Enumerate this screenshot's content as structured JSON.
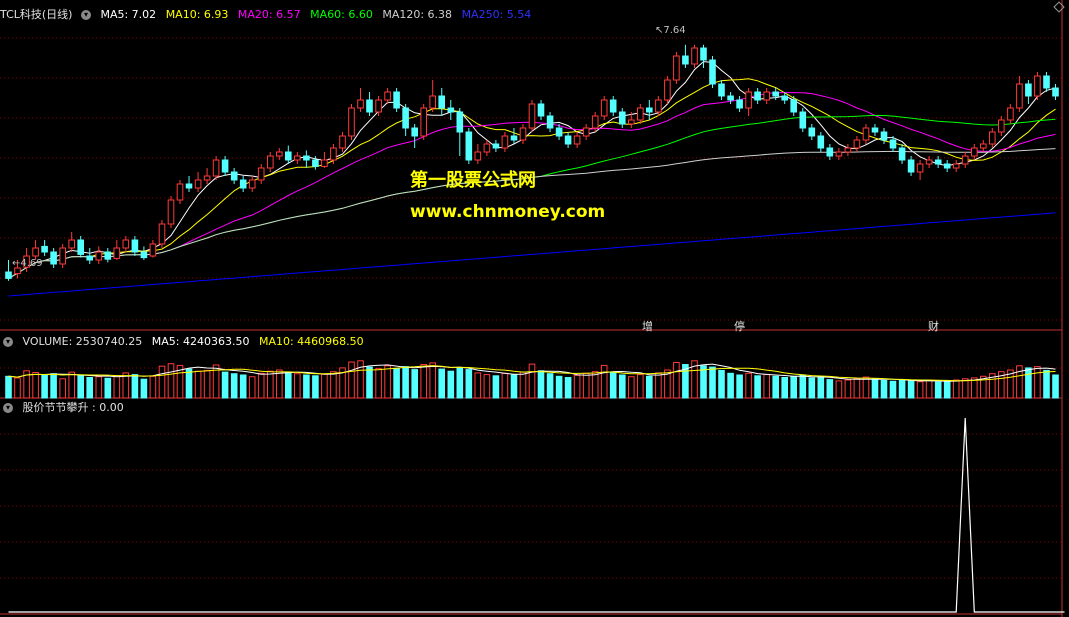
{
  "colors": {
    "up": "#ff3a3a",
    "down": "#54ffff",
    "ma5": "#ffffff",
    "ma10": "#ffff00",
    "ma20": "#ff00ff",
    "ma60": "#00ff00",
    "ma120": "#cfcfcf",
    "ma250": "#0000ff",
    "grid": "#8b0000",
    "watermark": "#ffff00"
  },
  "header": {
    "menu_icon": "chevron-down-icon",
    "title": "TCL科技(日线)",
    "ma5": "MA5: 7.02",
    "ma10": "MA10: 6.93",
    "ma20": "MA20: 6.57",
    "ma60": "MA60: 6.60",
    "ma120": "MA120: 6.38",
    "ma250": "MA250: 5.54"
  },
  "volume_header": {
    "label": "VOLUME: 2530740.25",
    "ma5": "MA5: 4240363.50",
    "ma10": "MA10: 4460968.50"
  },
  "indicator_header": {
    "label": "股价节节攀升 : 0.00"
  },
  "watermark": {
    "line1": "第一股票公式网",
    "line2": "www.chnmoney.com"
  },
  "annotations": {
    "low": "4.69",
    "high": "7.64"
  },
  "event_flags": [
    {
      "text": "增",
      "color": "#ff3a3a"
    },
    {
      "text": "停",
      "color": "#54ffff"
    },
    {
      "text": "财",
      "color": "#54ffff"
    }
  ],
  "chart_data": [
    {
      "type": "candlestick",
      "title": "TCL科技(日线)",
      "annotations": {
        "low": 4.69,
        "high": 7.64
      },
      "ylim": [
        4.3,
        7.9
      ],
      "candles": [
        [
          4.8,
          4.72,
          4.95,
          4.69
        ],
        [
          4.78,
          4.85,
          4.95,
          4.72
        ],
        [
          4.86,
          5.0,
          5.1,
          4.8
        ],
        [
          5.0,
          5.1,
          5.2,
          4.95
        ],
        [
          5.12,
          5.05,
          5.2,
          5.0
        ],
        [
          5.05,
          4.9,
          5.1,
          4.85
        ],
        [
          4.9,
          5.1,
          5.15,
          4.85
        ],
        [
          5.1,
          5.2,
          5.3,
          5.05
        ],
        [
          5.2,
          5.02,
          5.25,
          4.98
        ],
        [
          5.0,
          4.95,
          5.1,
          4.9
        ],
        [
          4.95,
          5.05,
          5.12,
          4.9
        ],
        [
          5.05,
          4.96,
          5.1,
          4.92
        ],
        [
          4.97,
          5.1,
          5.2,
          4.95
        ],
        [
          5.1,
          5.2,
          5.25,
          5.05
        ],
        [
          5.2,
          5.05,
          5.25,
          5.0
        ],
        [
          5.05,
          4.98,
          5.12,
          4.95
        ],
        [
          5.0,
          5.15,
          5.2,
          4.98
        ],
        [
          5.15,
          5.4,
          5.45,
          5.1
        ],
        [
          5.4,
          5.7,
          5.75,
          5.35
        ],
        [
          5.7,
          5.9,
          5.95,
          5.65
        ],
        [
          5.9,
          5.85,
          6.0,
          5.8
        ],
        [
          5.85,
          5.95,
          6.05,
          5.8
        ],
        [
          5.95,
          6.0,
          6.1,
          5.9
        ],
        [
          6.0,
          6.2,
          6.25,
          5.95
        ],
        [
          6.2,
          6.05,
          6.25,
          6.0
        ],
        [
          6.05,
          5.95,
          6.1,
          5.9
        ],
        [
          5.95,
          5.85,
          6.0,
          5.8
        ],
        [
          5.85,
          5.95,
          6.0,
          5.8
        ],
        [
          5.95,
          6.1,
          6.15,
          5.9
        ],
        [
          6.1,
          6.25,
          6.3,
          6.05
        ],
        [
          6.25,
          6.3,
          6.35,
          6.2
        ],
        [
          6.3,
          6.2,
          6.38,
          6.15
        ],
        [
          6.2,
          6.25,
          6.3,
          6.15
        ],
        [
          6.25,
          6.2,
          6.32,
          6.1
        ],
        [
          6.2,
          6.12,
          6.25,
          6.08
        ],
        [
          6.12,
          6.2,
          6.3,
          6.1
        ],
        [
          6.2,
          6.35,
          6.4,
          6.15
        ],
        [
          6.35,
          6.5,
          6.55,
          6.3
        ],
        [
          6.5,
          6.85,
          6.9,
          6.45
        ],
        [
          6.85,
          6.95,
          7.1,
          6.8
        ],
        [
          6.95,
          6.8,
          7.05,
          6.75
        ],
        [
          6.8,
          6.95,
          7.0,
          6.75
        ],
        [
          6.95,
          7.05,
          7.1,
          6.9
        ],
        [
          7.05,
          6.85,
          7.1,
          6.8
        ],
        [
          6.85,
          6.6,
          6.9,
          6.5
        ],
        [
          6.6,
          6.5,
          6.65,
          6.35
        ],
        [
          6.5,
          6.85,
          6.9,
          6.45
        ],
        [
          6.85,
          7.0,
          7.2,
          6.8
        ],
        [
          7.0,
          6.85,
          7.1,
          6.75
        ],
        [
          6.85,
          6.8,
          6.95,
          6.7
        ],
        [
          6.8,
          6.55,
          6.85,
          6.25
        ],
        [
          6.55,
          6.2,
          6.6,
          6.15
        ],
        [
          6.2,
          6.3,
          6.4,
          6.15
        ],
        [
          6.3,
          6.4,
          6.45,
          6.25
        ],
        [
          6.4,
          6.35,
          6.45,
          6.3
        ],
        [
          6.35,
          6.5,
          6.55,
          6.3
        ],
        [
          6.5,
          6.45,
          6.6,
          6.4
        ],
        [
          6.45,
          6.6,
          6.65,
          6.4
        ],
        [
          6.6,
          6.9,
          6.95,
          6.55
        ],
        [
          6.9,
          6.75,
          6.95,
          6.7
        ],
        [
          6.75,
          6.6,
          6.8,
          6.55
        ],
        [
          6.6,
          6.5,
          6.65,
          6.45
        ],
        [
          6.5,
          6.4,
          6.55,
          6.35
        ],
        [
          6.4,
          6.5,
          6.55,
          6.35
        ],
        [
          6.5,
          6.6,
          6.65,
          6.45
        ],
        [
          6.6,
          6.75,
          6.8,
          6.55
        ],
        [
          6.75,
          6.95,
          7.0,
          6.7
        ],
        [
          6.95,
          6.8,
          7.0,
          6.75
        ],
        [
          6.8,
          6.65,
          6.85,
          6.6
        ],
        [
          6.65,
          6.7,
          6.8,
          6.6
        ],
        [
          6.7,
          6.85,
          6.9,
          6.65
        ],
        [
          6.85,
          6.8,
          6.95,
          6.7
        ],
        [
          6.8,
          6.95,
          7.0,
          6.75
        ],
        [
          6.95,
          7.2,
          7.25,
          6.9
        ],
        [
          7.2,
          7.5,
          7.55,
          7.15
        ],
        [
          7.5,
          7.4,
          7.64,
          7.35
        ],
        [
          7.4,
          7.6,
          7.64,
          7.35
        ],
        [
          7.6,
          7.45,
          7.64,
          7.35
        ],
        [
          7.45,
          7.15,
          7.5,
          7.1
        ],
        [
          7.15,
          7.0,
          7.2,
          6.95
        ],
        [
          7.0,
          6.95,
          7.05,
          6.9
        ],
        [
          6.95,
          6.85,
          7.0,
          6.8
        ],
        [
          6.85,
          7.05,
          7.1,
          6.75
        ],
        [
          7.05,
          6.95,
          7.1,
          6.9
        ],
        [
          6.95,
          7.05,
          7.1,
          6.9
        ],
        [
          7.05,
          7.0,
          7.1,
          6.95
        ],
        [
          7.0,
          6.95,
          7.05,
          6.9
        ],
        [
          6.95,
          6.8,
          7.0,
          6.75
        ],
        [
          6.8,
          6.6,
          6.85,
          6.55
        ],
        [
          6.6,
          6.5,
          6.65,
          6.45
        ],
        [
          6.5,
          6.35,
          6.55,
          6.3
        ],
        [
          6.35,
          6.25,
          6.4,
          6.2
        ],
        [
          6.25,
          6.3,
          6.35,
          6.2
        ],
        [
          6.3,
          6.35,
          6.4,
          6.25
        ],
        [
          6.35,
          6.45,
          6.5,
          6.3
        ],
        [
          6.45,
          6.6,
          6.65,
          6.4
        ],
        [
          6.6,
          6.55,
          6.65,
          6.5
        ],
        [
          6.55,
          6.45,
          6.6,
          6.4
        ],
        [
          6.45,
          6.35,
          6.5,
          6.3
        ],
        [
          6.35,
          6.2,
          6.4,
          6.15
        ],
        [
          6.2,
          6.05,
          6.25,
          6.0
        ],
        [
          6.05,
          6.15,
          6.2,
          5.95
        ],
        [
          6.15,
          6.2,
          6.25,
          6.1
        ],
        [
          6.2,
          6.15,
          6.25,
          6.1
        ],
        [
          6.15,
          6.1,
          6.2,
          6.05
        ],
        [
          6.1,
          6.15,
          6.2,
          6.05
        ],
        [
          6.15,
          6.25,
          6.3,
          6.1
        ],
        [
          6.25,
          6.35,
          6.4,
          6.2
        ],
        [
          6.35,
          6.4,
          6.45,
          6.3
        ],
        [
          6.4,
          6.55,
          6.6,
          6.35
        ],
        [
          6.55,
          6.7,
          6.75,
          6.5
        ],
        [
          6.7,
          6.85,
          6.9,
          6.65
        ],
        [
          6.85,
          7.15,
          7.25,
          6.8
        ],
        [
          7.15,
          7.0,
          7.2,
          6.9
        ],
        [
          7.0,
          7.25,
          7.3,
          6.95
        ],
        [
          7.25,
          7.1,
          7.3,
          7.05
        ],
        [
          7.1,
          7.0,
          7.15,
          6.95
        ]
      ],
      "ma_lines": [
        {
          "name": "MA5",
          "value": 7.02
        },
        {
          "name": "MA10",
          "value": 6.93
        },
        {
          "name": "MA20",
          "value": 6.57
        },
        {
          "name": "MA60",
          "value": 6.6
        },
        {
          "name": "MA120",
          "value": 6.38
        },
        {
          "name": "MA250",
          "value": 5.54
        }
      ]
    },
    {
      "type": "bar",
      "title": "VOLUME",
      "ylim": [
        0,
        11000000
      ],
      "values": [
        5200000,
        4800000,
        6500000,
        6100000,
        5500000,
        5800000,
        4600000,
        6200000,
        5400000,
        4900000,
        5100000,
        4700000,
        5300000,
        6000000,
        5600000,
        4500000,
        5200000,
        7600000,
        8200000,
        7800000,
        6900000,
        6400000,
        6600000,
        7900000,
        6200000,
        5800000,
        5500000,
        5100000,
        5900000,
        6400000,
        6700000,
        6200000,
        5800000,
        5500000,
        5300000,
        5700000,
        6300000,
        7200000,
        8600000,
        8900000,
        7400000,
        7000000,
        7700000,
        7100000,
        7500000,
        6800000,
        8000000,
        8400000,
        6900000,
        6400000,
        7300000,
        6800000,
        6000000,
        5600000,
        5300000,
        5900000,
        5500000,
        6200000,
        8100000,
        6500000,
        5800000,
        5200000,
        4900000,
        5400000,
        5900000,
        6300000,
        7800000,
        6200000,
        5500000,
        5100000,
        5600000,
        5200000,
        6000000,
        6700000,
        8500000,
        8000000,
        8900000,
        7700000,
        7400000,
        6600000,
        5900000,
        5500000,
        5900000,
        5300000,
        5600000,
        5200000,
        4900000,
        5100000,
        5400000,
        4800000,
        5000000,
        4400000,
        4100000,
        4300000,
        4600000,
        5000000,
        4500000,
        4200000,
        4000000,
        4300000,
        4100000,
        3900000,
        4200000,
        3800000,
        4000000,
        4300000,
        4600000,
        4800000,
        5200000,
        5800000,
        6300000,
        6700000,
        7700000,
        7200000,
        7500000,
        6600000,
        5500000
      ],
      "ma5": 4240363.5,
      "ma10": 4460968.5
    },
    {
      "type": "line",
      "title": "股价节节攀升",
      "ylim": [
        0,
        1
      ],
      "values": [
        0,
        0,
        0,
        0,
        0,
        0,
        0,
        0,
        0,
        0,
        0,
        0,
        0,
        0,
        0,
        0,
        0,
        0,
        0,
        0,
        0,
        0,
        0,
        0,
        0,
        0,
        0,
        0,
        0,
        0,
        0,
        0,
        0,
        0,
        0,
        0,
        0,
        0,
        0,
        0,
        0,
        0,
        0,
        0,
        0,
        0,
        0,
        0,
        0,
        0,
        0,
        0,
        0,
        0,
        0,
        0,
        0,
        0,
        0,
        0,
        0,
        0,
        0,
        0,
        0,
        0,
        0,
        0,
        0,
        0,
        0,
        0,
        0,
        0,
        0,
        0,
        0,
        0,
        0,
        0,
        0,
        0,
        0,
        0,
        0,
        0,
        0,
        0,
        0,
        0,
        0,
        0,
        0,
        0,
        0,
        0,
        0,
        0,
        0,
        0,
        0,
        0,
        0,
        0,
        0,
        0,
        1,
        0,
        0,
        0,
        0,
        0,
        0,
        0,
        0,
        0,
        0,
        0
      ]
    }
  ]
}
